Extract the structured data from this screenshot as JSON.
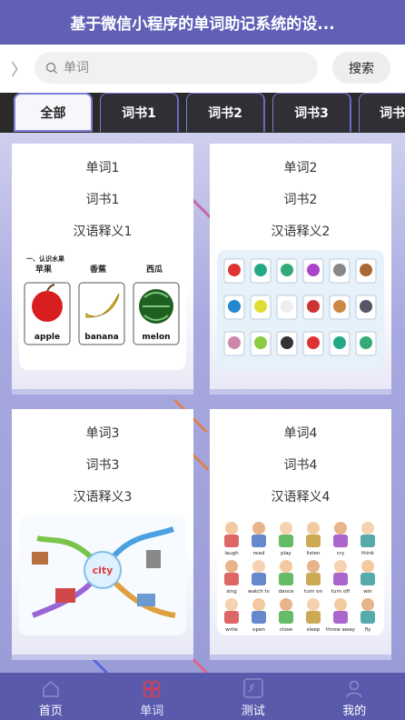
{
  "header": {
    "title": "基于微信小程序的单词助记系统的设..."
  },
  "search": {
    "placeholder": "单词",
    "button": "搜索",
    "back_icon": "〉"
  },
  "tabs": [
    "全部",
    "词书1",
    "词书2",
    "词书3",
    "词书"
  ],
  "cards": [
    {
      "word": "单词1",
      "book": "词书1",
      "meaning": "汉语释义1",
      "image": {
        "heading": "一、认识水果",
        "items": [
          {
            "cn": "苹果",
            "en": "apple"
          },
          {
            "cn": "香蕉",
            "en": "banana"
          },
          {
            "cn": "西瓜",
            "en": "melon"
          }
        ]
      }
    },
    {
      "word": "单词2",
      "book": "词书2",
      "meaning": "汉语释义2"
    },
    {
      "word": "单词3",
      "book": "词书3",
      "meaning": "汉语释义3",
      "image": {
        "center_label": "city"
      }
    },
    {
      "word": "单词4",
      "book": "词书4",
      "meaning": "汉语释义4",
      "image": {
        "row1": [
          "laugh",
          "read",
          "play",
          "listen",
          "cry",
          "think"
        ],
        "row2": [
          "sing",
          "watch tv",
          "dance",
          "turn on",
          "turn off",
          "win"
        ],
        "row3": [
          "write",
          "open",
          "close",
          "sleep",
          "throw away",
          "fly"
        ]
      }
    }
  ],
  "bottom_nav": [
    {
      "label": "首页",
      "icon": "home-icon"
    },
    {
      "label": "单词",
      "icon": "flower-icon",
      "active": true
    },
    {
      "label": "测试",
      "icon": "test-icon"
    },
    {
      "label": "我的",
      "icon": "user-icon"
    }
  ],
  "colors": {
    "header": "#6060b6",
    "tab_bar": "#2a2a2a",
    "bottom_bar": "#5a5aad",
    "active_icon": "#d0405a"
  }
}
